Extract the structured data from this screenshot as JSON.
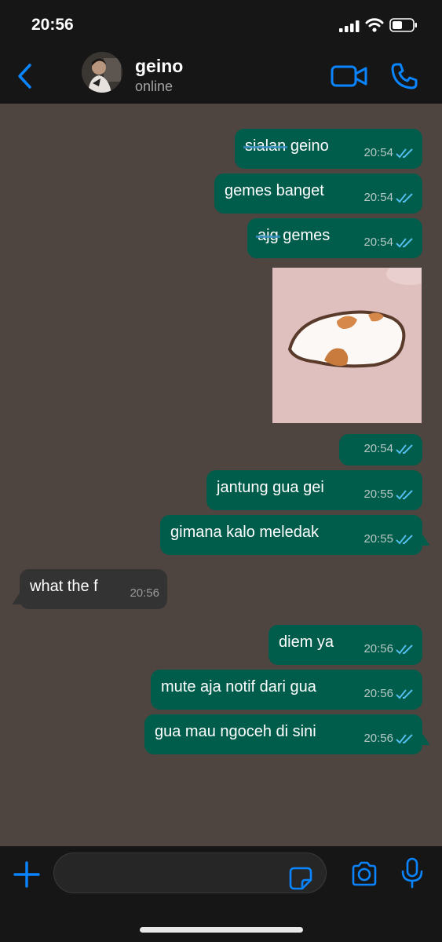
{
  "status_bar": {
    "time": "20:56"
  },
  "header": {
    "contact_name": "geino",
    "contact_status": "online"
  },
  "messages": [
    {
      "text_struck": "sialan",
      "text": " geino",
      "time": "20:54"
    },
    {
      "text": "gemes banget",
      "time": "20:54"
    },
    {
      "text_struck": "ajg",
      "text": " gemes",
      "time": "20:54"
    },
    {
      "time": "20:54",
      "sticker": "hamster-sticker"
    },
    {
      "text": "jantung gua gei",
      "time": "20:55"
    },
    {
      "text": "gimana kalo meledak",
      "time": "20:55"
    },
    {
      "text": "what the f",
      "time": "20:56"
    },
    {
      "text": "diem ya",
      "time": "20:56"
    },
    {
      "text": "mute aja notif dari gua",
      "time": "20:56"
    },
    {
      "text": "gua mau ngoceh di sini",
      "time": "20:56"
    }
  ],
  "composer": {
    "placeholder": ""
  },
  "colors": {
    "accent": "#0a84ff",
    "outgoing": "#005c4b",
    "incoming": "#333333",
    "chat_bg": "#4f4540",
    "read_ticks": "#53bdeb"
  },
  "icons": [
    "back-icon",
    "video-call-icon",
    "phone-icon",
    "plus-icon",
    "sticker-icon",
    "camera-icon",
    "microphone-icon",
    "double-check-icon"
  ]
}
